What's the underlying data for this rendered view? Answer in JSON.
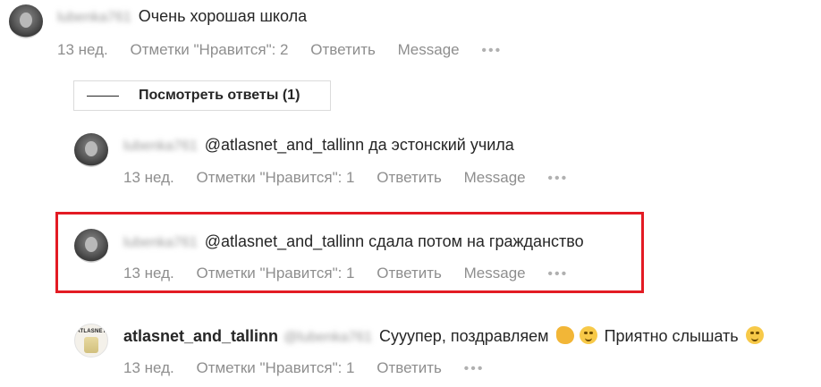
{
  "comments": [
    {
      "username_blurred": "lubenka761",
      "text": "Очень хорошая школа",
      "meta": {
        "time": "13 нед.",
        "likes": "Отметки \"Нравится\": 2",
        "reply": "Ответить",
        "message": "Message",
        "more": "•••"
      }
    },
    {
      "username_blurred": "lubenka761",
      "text": "@atlasnet_and_tallinn да эстонский учила",
      "meta": {
        "time": "13 нед.",
        "likes": "Отметки \"Нравится\": 1",
        "reply": "Ответить",
        "message": "Message",
        "more": "•••"
      }
    },
    {
      "username_blurred": "lubenka761",
      "text": "@atlasnet_and_tallinn сдала потом на гражданство",
      "meta": {
        "time": "13 нед.",
        "likes": "Отметки \"Нравится\": 1",
        "reply": "Ответить",
        "message": "Message",
        "more": "•••"
      }
    },
    {
      "author": "atlasnet_and_tallinn",
      "mention_blurred": "@lubenka761",
      "text_part1": "Сууупер, поздравляем",
      "text_part2": "Приятно слышать",
      "meta": {
        "time": "13 нед.",
        "likes": "Отметки \"Нравится\": 1",
        "reply": "Ответить",
        "more": "•••"
      }
    }
  ],
  "view_replies": "Посмотреть ответы (1)",
  "brand_avatar_text": "ATLASNET",
  "highlight_color": "#e31b23"
}
